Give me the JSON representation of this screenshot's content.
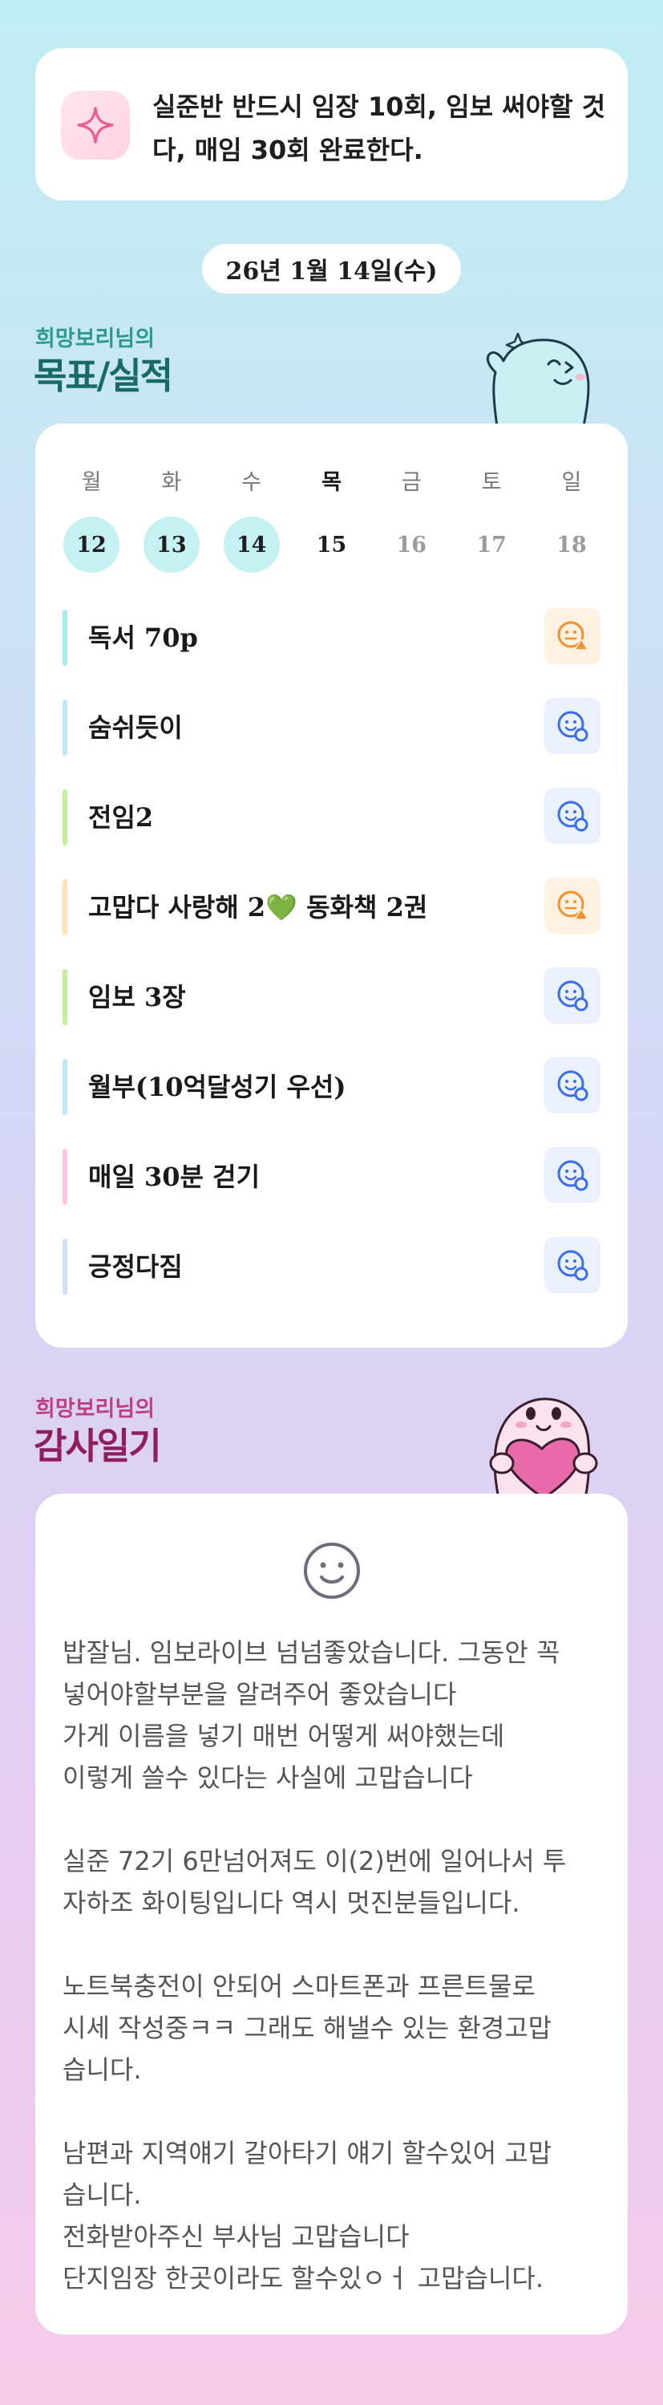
{
  "goal_banner": {
    "icon": "sparkle-icon",
    "text": "실준반 반드시 임장 10회, 임보 써야할 것 다, 매임 30회 완료한다."
  },
  "date": "26년 1월 14일(수)",
  "goals_section": {
    "subtitle": "희망보리님의",
    "title": "목표/실적",
    "week": [
      {
        "day": "월",
        "date": "12",
        "state": "done"
      },
      {
        "day": "화",
        "date": "13",
        "state": "done"
      },
      {
        "day": "수",
        "date": "14",
        "state": "done"
      },
      {
        "day": "목",
        "date": "15",
        "state": "today"
      },
      {
        "day": "금",
        "date": "16",
        "state": "future"
      },
      {
        "day": "토",
        "date": "17",
        "state": "future"
      },
      {
        "day": "일",
        "date": "18",
        "state": "future"
      }
    ],
    "tasks": [
      {
        "label": "독서 70p",
        "status": "warn",
        "bar_color": "#a8ecec"
      },
      {
        "label": "숨쉬듯이",
        "status": "ok",
        "bar_color": "#bfe9f5"
      },
      {
        "label": "전임2",
        "status": "ok",
        "bar_color": "#c6ef9f"
      },
      {
        "label": "고맙다 사랑해 2💚 동화책 2권",
        "status": "warn",
        "bar_color": "#ffe0b8"
      },
      {
        "label": "임보 3장",
        "status": "ok",
        "bar_color": "#c6ef9f"
      },
      {
        "label": "월부(10억달성기 우선)",
        "status": "ok",
        "bar_color": "#bfe9f5"
      },
      {
        "label": "매일 30분 걷기",
        "status": "ok",
        "bar_color": "#ffc6e3"
      },
      {
        "label": "긍정다짐",
        "status": "ok",
        "bar_color": "#cfe0f7"
      }
    ]
  },
  "gratitude_section": {
    "subtitle": "희망보리님의",
    "title": "감사일기",
    "paragraphs": [
      "밥잘님. 임보라이브 넘넘좋았습니다. 그동안 꼭\n넣어야할부분을 알려주어 좋았습니다\n가게 이름을 넣기 매번 어떻게 써야했는데\n이렇게 쓸수 있다는 사실에 고맙습니다",
      "실준 72기 6만넘어져도 이(2)번에 일어나서 투\n자하조 화이팅입니다 역시 멋진분들입니다.",
      "노트북충전이 안되어 스마트폰과 프른트물로\n시세 작성중ㅋㅋ 그래도 해낼수 있는 환경고맙\n습니다.",
      "남편과 지역얘기 갈아타기 얘기 할수있어 고맙\n습니다.\n전화받아주신 부사님 고맙습니다\n단지임장 한곳이라도 할수있ㅇㅓ 고맙습니다."
    ]
  },
  "colors": {
    "accent_blue": "#3a6ee8",
    "accent_orange": "#f2922e",
    "done_circle": "#c5f1f3"
  }
}
